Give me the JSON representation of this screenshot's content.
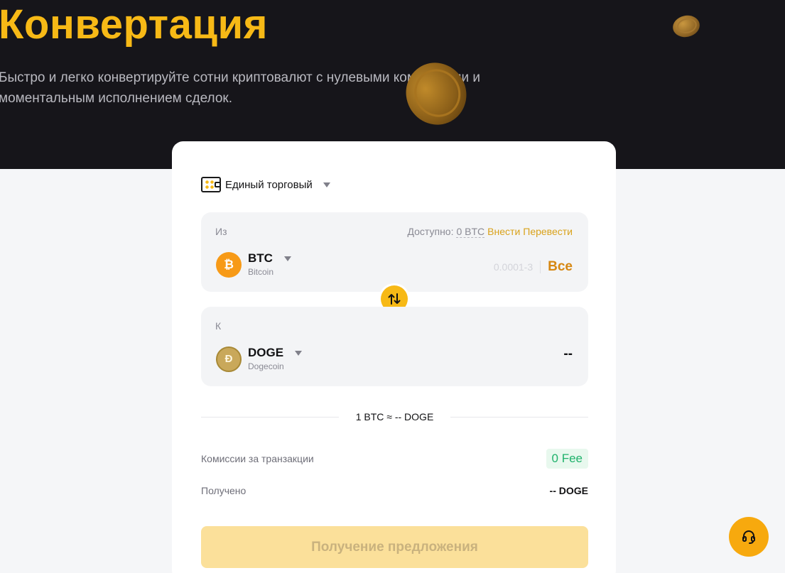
{
  "hero": {
    "title": "Конвертация",
    "subtitle": "Быстро и легко конвертируйте сотни криптовалют с нулевыми комиссиями и моментальным исполнением сделок."
  },
  "account": {
    "label": "Единый торговый",
    "icon": "wallet-icon"
  },
  "from": {
    "label": "Из",
    "available_label": "Доступно:",
    "available_amount": "0 BTC",
    "deposit_link": "Внести",
    "transfer_link": "Перевести",
    "asset_code": "BTC",
    "asset_name": "Bitcoin",
    "asset_icon_glyph": "₿",
    "range_placeholder": "0.0001-3",
    "all_button": "Все"
  },
  "to": {
    "label": "К",
    "asset_code": "DOGE",
    "asset_name": "Dogecoin",
    "asset_icon_glyph": "Ð",
    "value": "--"
  },
  "rate": {
    "text": "1 BTC ≈ -- DOGE"
  },
  "fee": {
    "label": "Комиссии за транзакции",
    "value": "0 Fee"
  },
  "received": {
    "label": "Получено",
    "value": "-- DOGE"
  },
  "cta": {
    "label": "Получение предложения"
  },
  "colors": {
    "accent": "#f7b916",
    "hero_bg": "#16151a",
    "fee_green": "#20b26c",
    "all_orange": "#d68712"
  }
}
